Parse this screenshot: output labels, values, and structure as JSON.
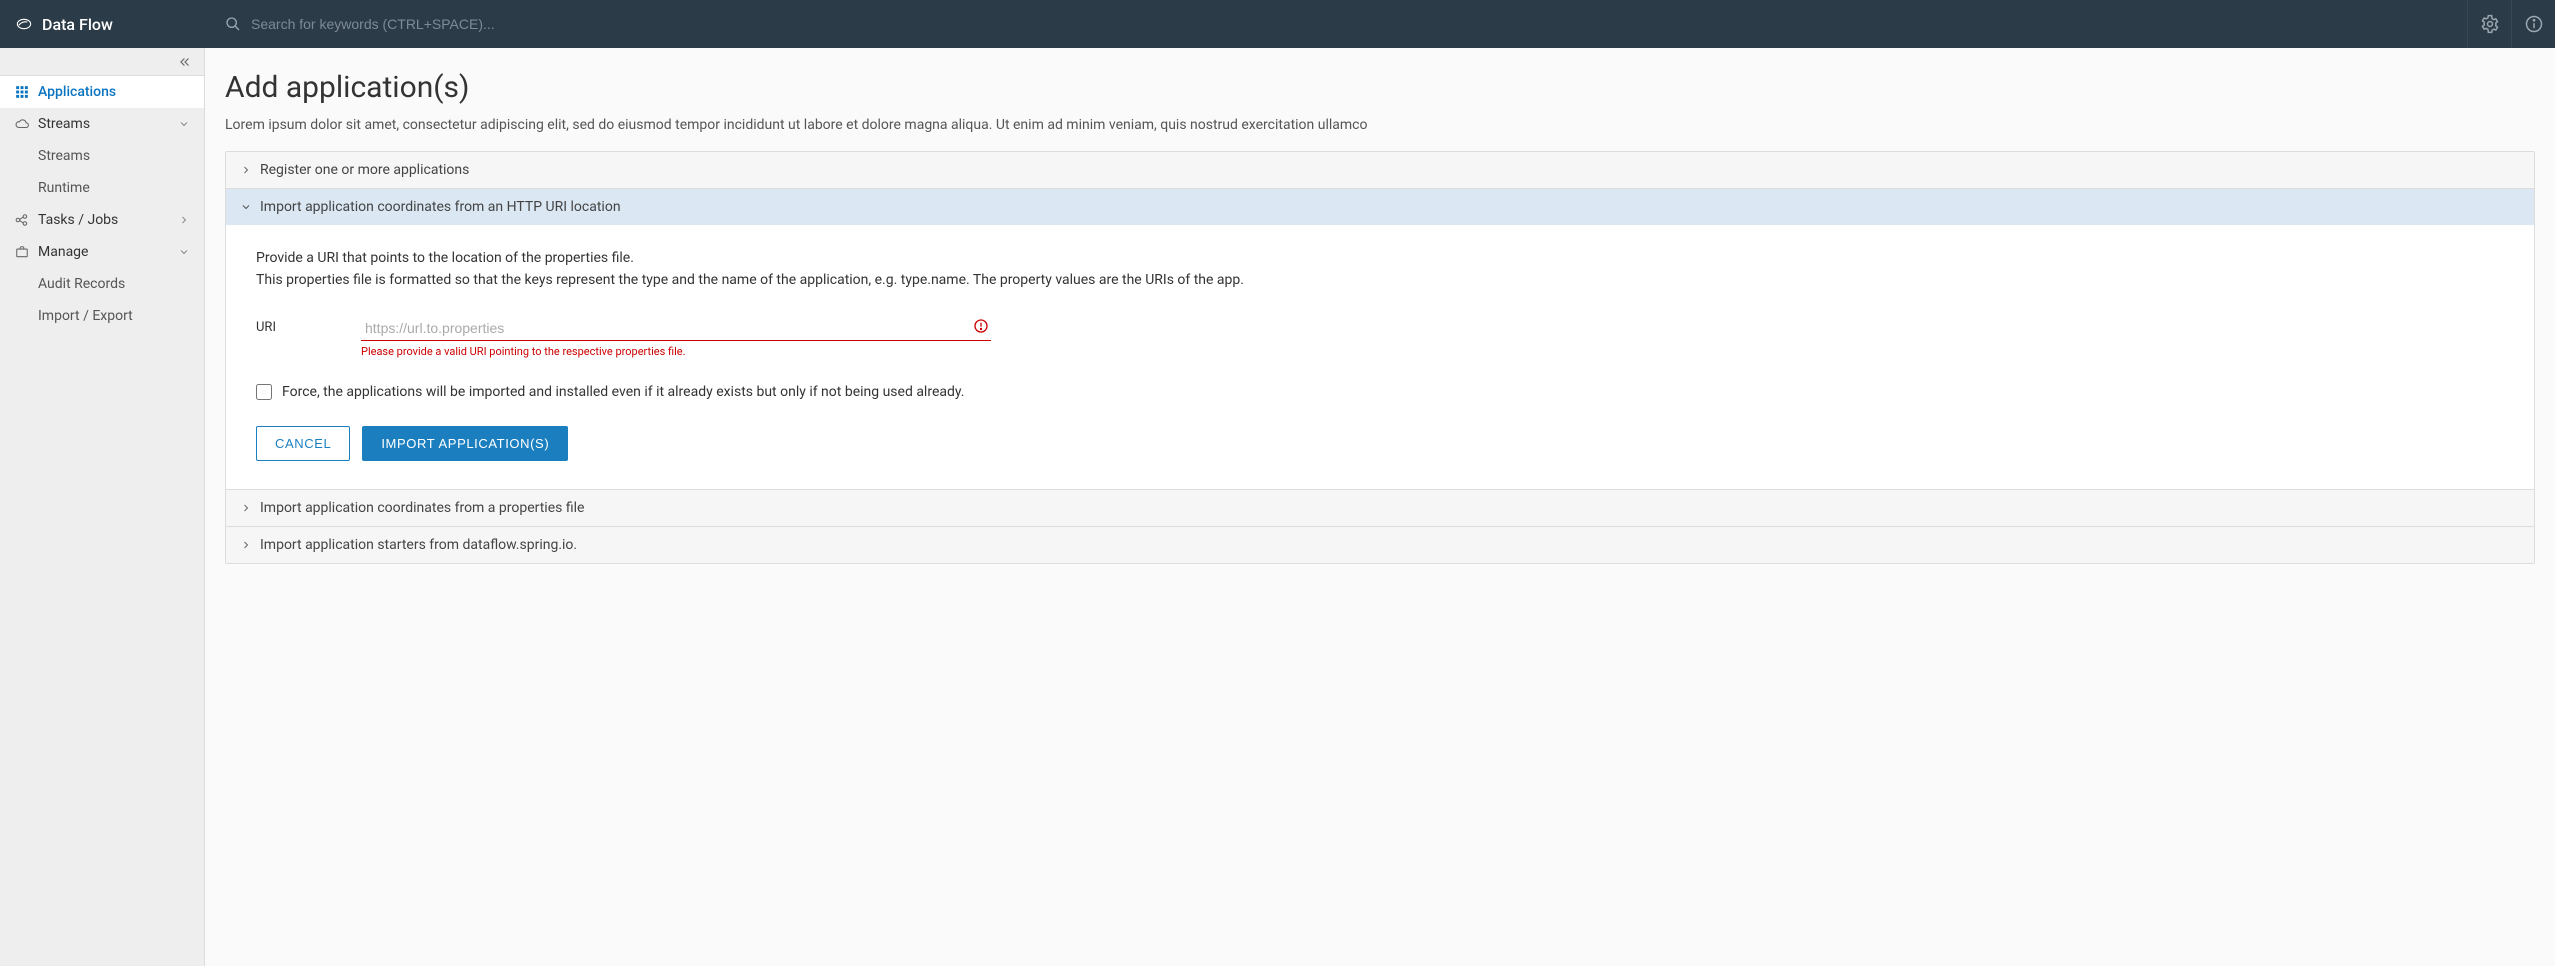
{
  "header": {
    "brand": "Data Flow",
    "search_placeholder": "Search for keywords (CTRL+SPACE)..."
  },
  "sidebar": {
    "items": [
      {
        "id": "applications",
        "label": "Applications"
      },
      {
        "id": "streams",
        "label": "Streams"
      },
      {
        "id": "tasks",
        "label": "Tasks / Jobs"
      },
      {
        "id": "manage",
        "label": "Manage"
      }
    ],
    "streams_children": [
      {
        "id": "streams-sub",
        "label": "Streams"
      },
      {
        "id": "runtime",
        "label": "Runtime"
      }
    ],
    "manage_children": [
      {
        "id": "audit",
        "label": "Audit Records"
      },
      {
        "id": "impexp",
        "label": "Import / Export"
      }
    ]
  },
  "main": {
    "title": "Add application(s)",
    "subtitle": "Lorem ipsum dolor sit amet, consectetur adipiscing elit, sed do eiusmod tempor incididunt ut labore et dolore magna aliqua. Ut enim ad minim veniam, quis nostrud exercitation ullamco",
    "accordion": [
      {
        "id": "register",
        "title": "Register one or more applications"
      },
      {
        "id": "import-uri",
        "title": "Import application coordinates from an HTTP URI location"
      },
      {
        "id": "import-file",
        "title": "Import application coordinates from a properties file"
      },
      {
        "id": "import-start",
        "title": "Import application starters from dataflow.spring.io."
      }
    ],
    "import_uri_panel": {
      "desc_line1": "Provide a URI that points to the location of the properties file.",
      "desc_line2": "This properties file is formatted so that the keys represent the type and the name of the application, e.g. type.name. The property values are the URIs of the app.",
      "uri_label": "URI",
      "uri_placeholder": "https://url.to.properties",
      "uri_error": "Please provide a valid URI pointing to the respective properties file.",
      "force_label": "Force, the applications will be imported and installed even if it already exists but only if not being used already.",
      "cancel_label": "CANCEL",
      "submit_label": "IMPORT APPLICATION(S)"
    }
  }
}
